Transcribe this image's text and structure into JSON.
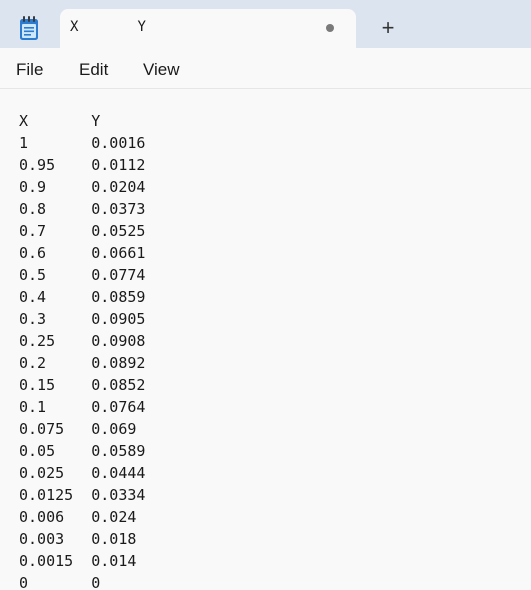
{
  "app": {
    "icon": "notepad-icon",
    "accent_color": "#2b7bd0"
  },
  "tab": {
    "title": "X\tY",
    "unsaved_indicator": "dot-icon",
    "new_tab_label": "+"
  },
  "menu": {
    "file": "File",
    "edit": "Edit",
    "view": "View"
  },
  "document": {
    "content": "X\tY\n1\t0.0016\n0.95\t0.0112\n0.9\t0.0204\n0.8\t0.0373\n0.7\t0.0525\n0.6\t0.0661\n0.5\t0.0774\n0.4\t0.0859\n0.3\t0.0905\n0.25\t0.0908\n0.2\t0.0892\n0.15\t0.0852\n0.1\t0.0764\n0.075\t0.069\n0.05\t0.0589\n0.025\t0.0444\n0.0125\t0.0334\n0.006\t0.024\n0.003\t0.018\n0.0015\t0.014\n0\t0"
  }
}
